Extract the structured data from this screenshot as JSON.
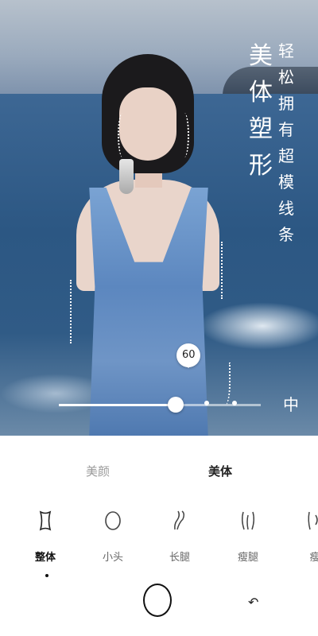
{
  "slogan": {
    "main": "美体塑形",
    "sub": "轻松拥有超模线条"
  },
  "slider": {
    "value": 60,
    "value_label": "60",
    "fraction": 0.58
  },
  "compare_label": "中",
  "tabs": [
    {
      "label": "美颜",
      "active": false
    },
    {
      "label": "美体",
      "active": true
    }
  ],
  "tools": [
    {
      "label": "整体",
      "icon": "body-outline-icon",
      "selected": true
    },
    {
      "label": "小头",
      "icon": "head-outline-icon",
      "selected": false
    },
    {
      "label": "长腿",
      "icon": "long-leg-icon",
      "selected": false
    },
    {
      "label": "瘦腿",
      "icon": "slim-leg-icon",
      "selected": false
    },
    {
      "label": "瘦",
      "icon": "slim-icon",
      "selected": false
    }
  ],
  "undo_icon": "↶",
  "colors": {
    "accent": "#111111",
    "inactive": "#9a9a9a",
    "panel": "#ffffff"
  }
}
